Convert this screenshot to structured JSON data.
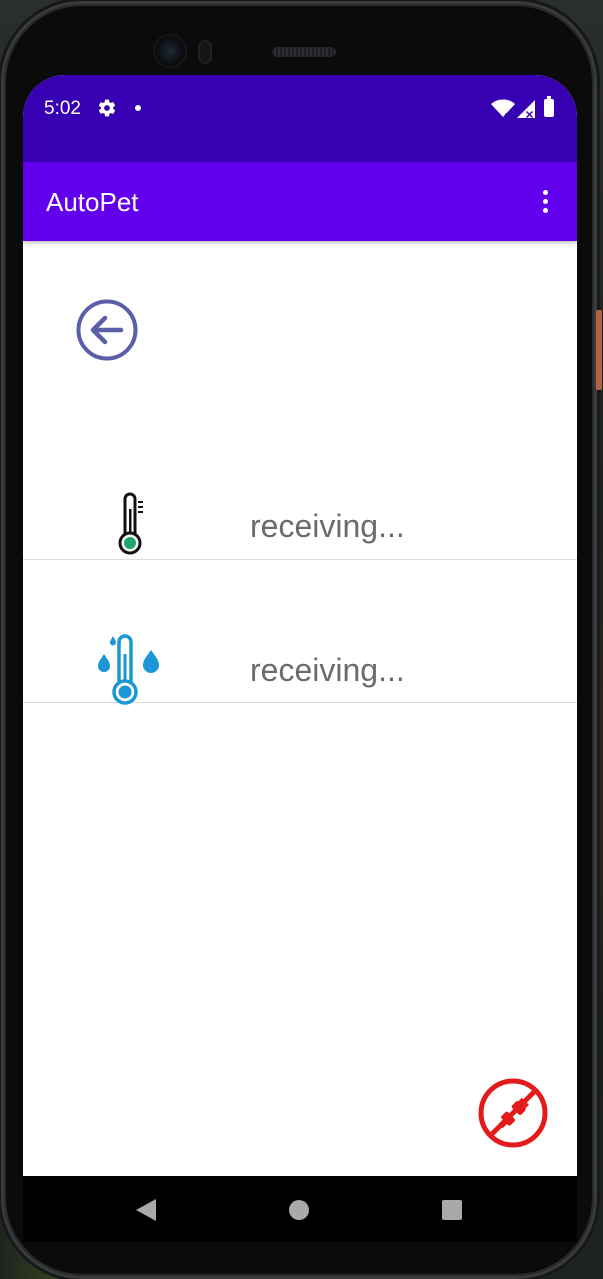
{
  "status_bar": {
    "time": "5:02",
    "icons": [
      "gear-icon",
      "notification-dot-icon",
      "wifi-icon",
      "signal-icon",
      "battery-icon"
    ]
  },
  "app_bar": {
    "title": "AutoPet",
    "menu_icon": "more-vert-icon"
  },
  "colors": {
    "status_bar": "#3700b3",
    "app_bar": "#6200ee",
    "back_icon": "#5b5fa8",
    "humidity_icon": "#1b96d6",
    "thermometer_fill": "#1ea66a",
    "disconnect": "#e31b1b",
    "value_text": "#6b6b6b"
  },
  "main": {
    "back_icon": "arrow-left-circle-icon",
    "readings": [
      {
        "icon": "thermometer-icon",
        "value": "receiving..."
      },
      {
        "icon": "humidity-thermometer-icon",
        "value": "receiving..."
      }
    ],
    "fab_icon": "plug-disconnected-icon"
  },
  "nav_bar": {
    "icons": [
      "nav-back-icon",
      "nav-home-icon",
      "nav-recents-icon"
    ]
  }
}
